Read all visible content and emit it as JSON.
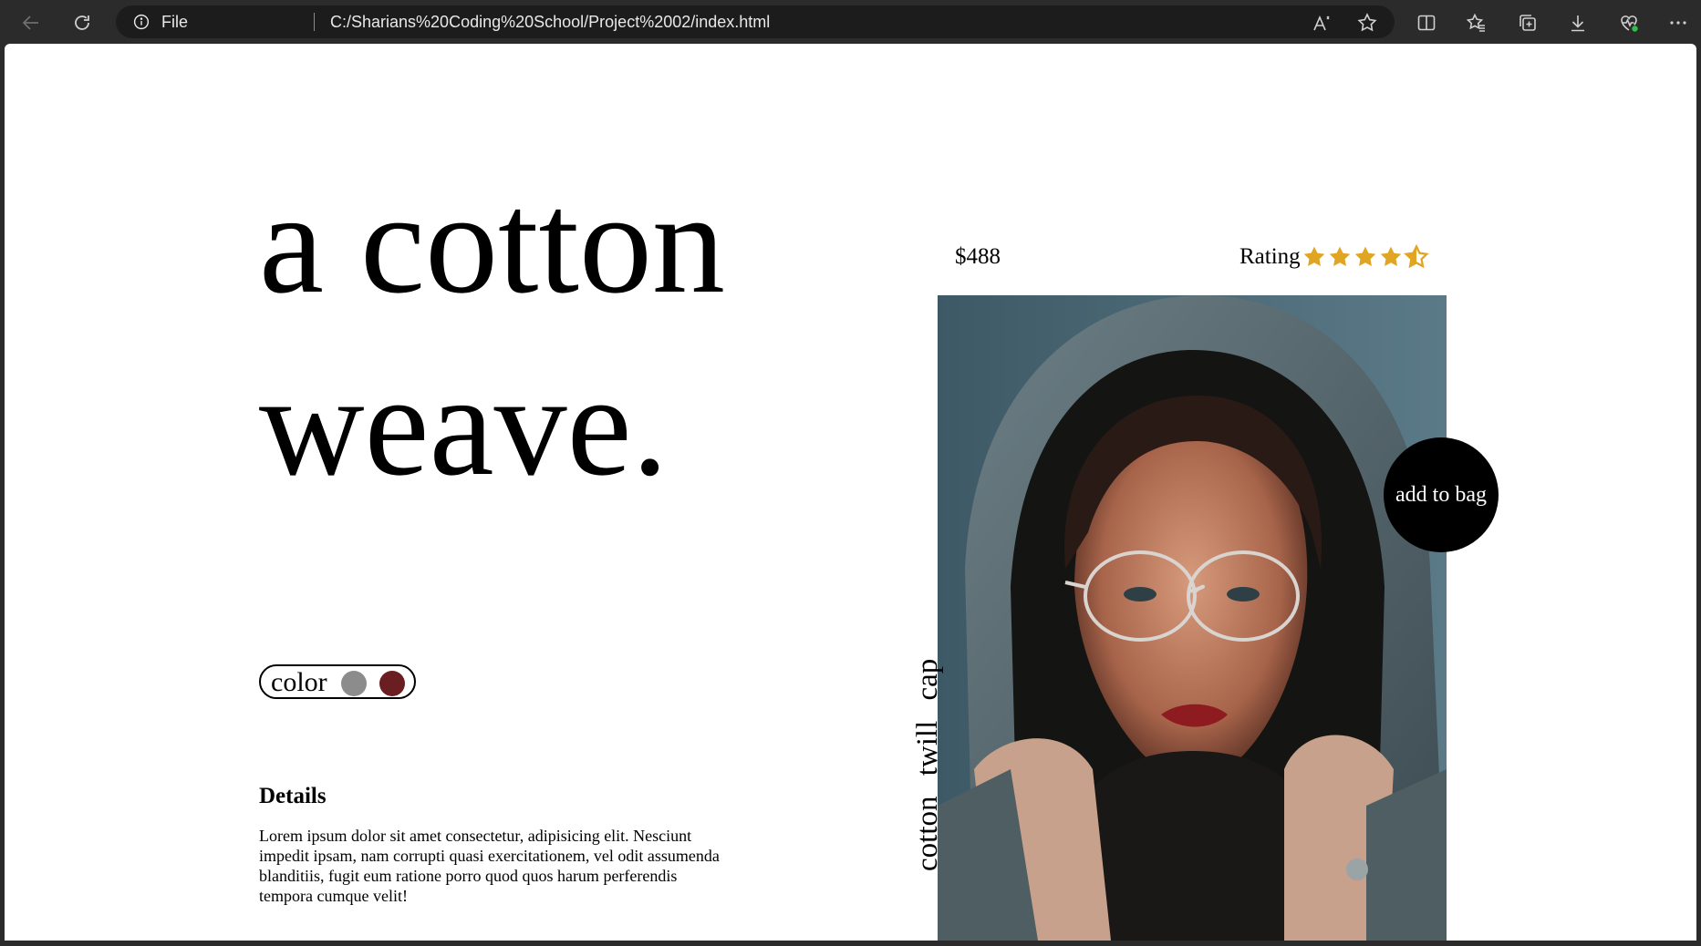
{
  "browser": {
    "scheme_label": "File",
    "url": "C:/Sharians%20Coding%20School/Project%2002/index.html",
    "read_aloud_label": "A",
    "icons": [
      "back-arrow-icon",
      "reload-icon",
      "info-icon",
      "read-aloud-icon",
      "favorite-star-icon",
      "split-screen-icon",
      "favorites-icon",
      "collections-icon",
      "download-icon",
      "browser-essentials-icon",
      "more-menu-icon"
    ]
  },
  "product": {
    "headline_line1": "a cotton",
    "headline_line2": "weave.",
    "price": "$488",
    "rating_label": "Rating",
    "rating": {
      "value": 4.5,
      "max": 5
    },
    "color_label": "color",
    "colors": [
      "#8c8c8c",
      "#6b1e22"
    ],
    "vertical_label": "cotton twill cap",
    "add_to_bag_label": "add to bag",
    "details_heading": "Details",
    "details_text": "Lorem ipsum dolor sit amet consectetur, adipisicing elit. Nesciunt impedit ipsam, nam corrupti quasi exercitationem, vel odit assumenda blanditiis, fugit eum ratione porro quod quos harum perferendis tempora cumque velit!"
  },
  "colors": {
    "star": "#e0a623",
    "button_bg": "#000000",
    "chrome_bg": "#2b2b2b"
  }
}
